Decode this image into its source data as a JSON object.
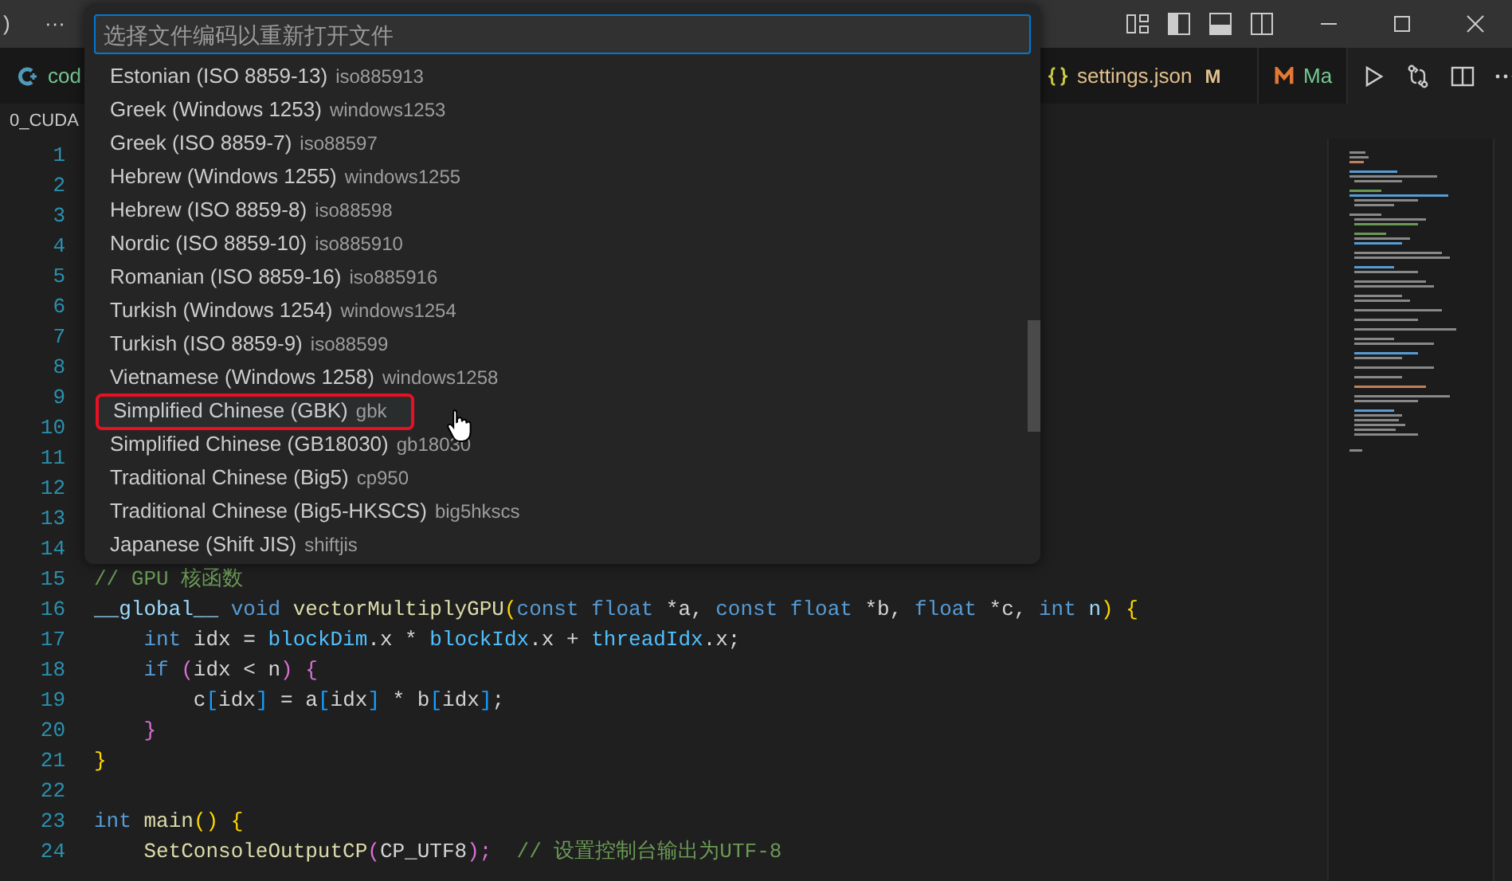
{
  "title_bar": {
    "menu_fragment": ")",
    "more": "···"
  },
  "tabs": [
    {
      "label": "cod",
      "kind": "cpp",
      "selected": false,
      "modified": false
    },
    {
      "label": "settings.json",
      "kind": "json",
      "selected": false,
      "modified": true,
      "badge": "M"
    },
    {
      "label": "Ma",
      "kind": "markdown",
      "selected": false,
      "modified": false
    }
  ],
  "breadcrumb": "0_CUDA",
  "quick_pick": {
    "placeholder": "选择文件编码以重新打开文件",
    "items": [
      {
        "label": "Estonian (ISO 8859-13)",
        "description": "iso885913",
        "selected": false
      },
      {
        "label": "Greek (Windows 1253)",
        "description": "windows1253",
        "selected": false
      },
      {
        "label": "Greek (ISO 8859-7)",
        "description": "iso88597",
        "selected": false
      },
      {
        "label": "Hebrew (Windows 1255)",
        "description": "windows1255",
        "selected": false
      },
      {
        "label": "Hebrew (ISO 8859-8)",
        "description": "iso88598",
        "selected": false
      },
      {
        "label": "Nordic (ISO 8859-10)",
        "description": "iso885910",
        "selected": false
      },
      {
        "label": "Romanian (ISO 8859-16)",
        "description": "iso885916",
        "selected": false
      },
      {
        "label": "Turkish (Windows 1254)",
        "description": "windows1254",
        "selected": false
      },
      {
        "label": "Turkish (ISO 8859-9)",
        "description": "iso88599",
        "selected": false
      },
      {
        "label": "Vietnamese (Windows 1258)",
        "description": "windows1258",
        "selected": false
      },
      {
        "label": "Simplified Chinese (GBK)",
        "description": "gbk",
        "selected": true
      },
      {
        "label": "Simplified Chinese (GB18030)",
        "description": "gb18030",
        "selected": false
      },
      {
        "label": "Traditional Chinese (Big5)",
        "description": "cp950",
        "selected": false
      },
      {
        "label": "Traditional Chinese (Big5-HKSCS)",
        "description": "big5hkscs",
        "selected": false
      },
      {
        "label": "Japanese (Shift JIS)",
        "description": "shiftjis",
        "selected": false
      }
    ]
  },
  "code_lines": [
    {
      "number": "1"
    },
    {
      "number": "2"
    },
    {
      "number": "3"
    },
    {
      "number": "4"
    },
    {
      "number": "5"
    },
    {
      "number": "6"
    },
    {
      "number": "7"
    },
    {
      "number": "8"
    },
    {
      "number": "9"
    },
    {
      "number": "10"
    },
    {
      "number": "11"
    },
    {
      "number": "12"
    },
    {
      "number": "13"
    },
    {
      "number": "14"
    },
    {
      "number": "15",
      "tokens": [
        {
          "text": "// GPU 核函数",
          "color": "#6a9955"
        }
      ]
    },
    {
      "number": "16",
      "tokens": [
        {
          "text": "__global__ ",
          "color": "#9cdcfe"
        },
        {
          "text": "void ",
          "color": "#569cd6"
        },
        {
          "text": "vectorMultiplyGPU",
          "color": "#dcdcaa"
        },
        {
          "text": "(",
          "color": "#ffd700"
        },
        {
          "text": "const float ",
          "color": "#569cd6"
        },
        {
          "text": "*a, ",
          "color": "#d4d4d4"
        },
        {
          "text": "const float ",
          "color": "#569cd6"
        },
        {
          "text": "*b, ",
          "color": "#d4d4d4"
        },
        {
          "text": "float ",
          "color": "#569cd6"
        },
        {
          "text": "*c, ",
          "color": "#d4d4d4"
        },
        {
          "text": "int ",
          "color": "#569cd6"
        },
        {
          "text": "n",
          "color": "#9cdcfe"
        },
        {
          "text": ") ",
          "color": "#ffd700"
        },
        {
          "text": "{",
          "color": "#ffd700"
        }
      ]
    },
    {
      "number": "17",
      "tokens": [
        {
          "text": "    int ",
          "color": "#569cd6"
        },
        {
          "text": "idx = ",
          "color": "#d4d4d4"
        },
        {
          "text": "blockDim",
          "color": "#4fc1ff"
        },
        {
          "text": ".x * ",
          "color": "#d4d4d4"
        },
        {
          "text": "blockIdx",
          "color": "#4fc1ff"
        },
        {
          "text": ".x + ",
          "color": "#d4d4d4"
        },
        {
          "text": "threadIdx",
          "color": "#4fc1ff"
        },
        {
          "text": ".x;",
          "color": "#d4d4d4"
        }
      ]
    },
    {
      "number": "18",
      "tokens": [
        {
          "text": "    if ",
          "color": "#569cd6"
        },
        {
          "text": "(",
          "color": "#da70d6"
        },
        {
          "text": "idx < n",
          "color": "#d4d4d4"
        },
        {
          "text": ") {",
          "color": "#da70d6"
        }
      ]
    },
    {
      "number": "19",
      "tokens": [
        {
          "text": "        c",
          "color": "#d4d4d4"
        },
        {
          "text": "[",
          "color": "#179fff"
        },
        {
          "text": "idx",
          "color": "#d4d4d4"
        },
        {
          "text": "]",
          "color": "#179fff"
        },
        {
          "text": " = a",
          "color": "#d4d4d4"
        },
        {
          "text": "[",
          "color": "#179fff"
        },
        {
          "text": "idx",
          "color": "#d4d4d4"
        },
        {
          "text": "]",
          "color": "#179fff"
        },
        {
          "text": " * b",
          "color": "#d4d4d4"
        },
        {
          "text": "[",
          "color": "#179fff"
        },
        {
          "text": "idx",
          "color": "#d4d4d4"
        },
        {
          "text": "]",
          "color": "#179fff"
        },
        {
          "text": ";",
          "color": "#d4d4d4"
        }
      ]
    },
    {
      "number": "20",
      "tokens": [
        {
          "text": "    }",
          "color": "#da70d6"
        }
      ]
    },
    {
      "number": "21",
      "tokens": [
        {
          "text": "}",
          "color": "#ffd700"
        }
      ]
    },
    {
      "number": "22"
    },
    {
      "number": "23",
      "tokens": [
        {
          "text": "int ",
          "color": "#569cd6"
        },
        {
          "text": "main",
          "color": "#dcdcaa"
        },
        {
          "text": "() {",
          "color": "#ffd700"
        }
      ]
    },
    {
      "number": "24",
      "tokens": [
        {
          "text": "    SetConsoleOutputCP",
          "color": "#dcdcaa"
        },
        {
          "text": "(",
          "color": "#da70d6"
        },
        {
          "text": "CP_UTF8",
          "color": "#d4d4d4"
        },
        {
          "text": ");  ",
          "color": "#da70d6"
        },
        {
          "text": "// 设置控制台输出为UTF-8",
          "color": "#6a9955"
        }
      ]
    }
  ]
}
